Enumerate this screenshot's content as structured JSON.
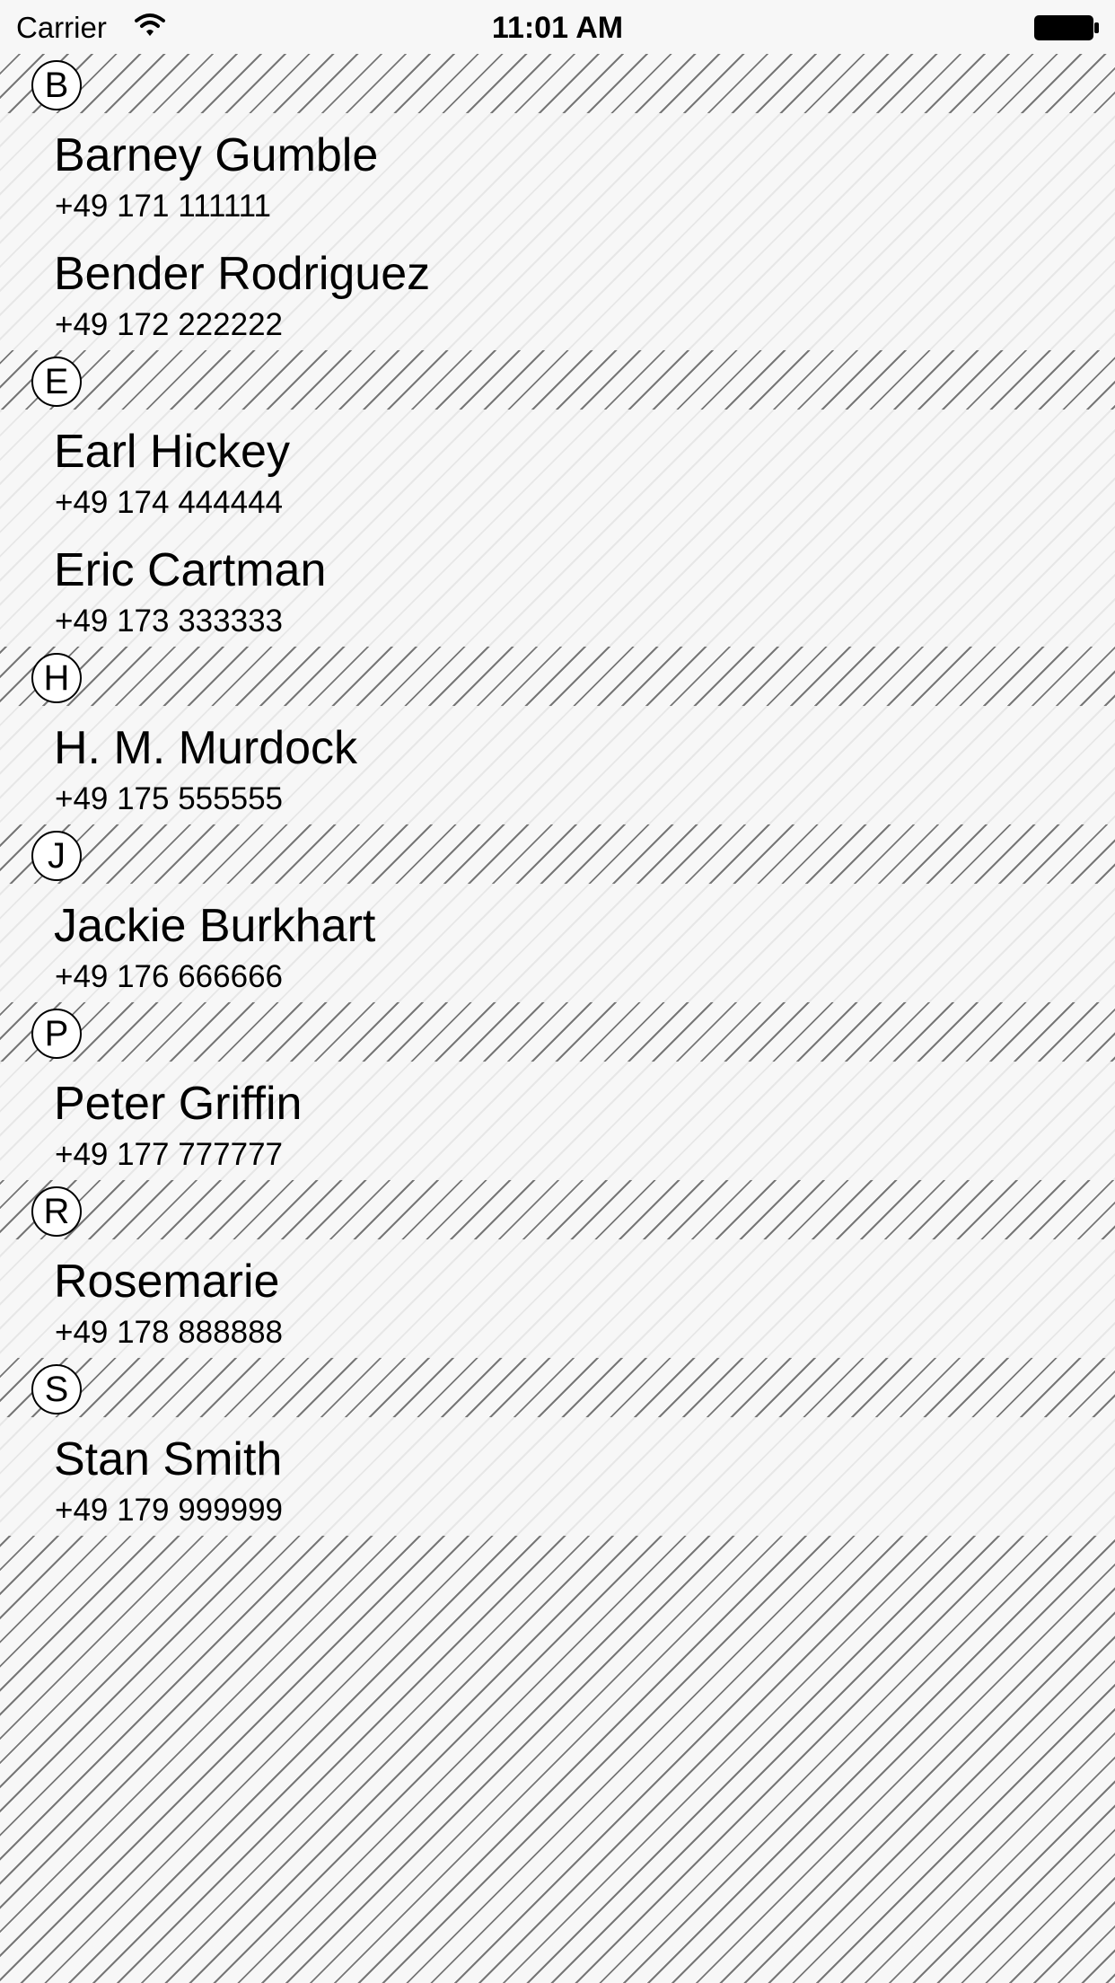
{
  "status_bar": {
    "carrier": "Carrier",
    "time": "11:01 AM",
    "wifi_icon": "wifi-icon",
    "battery_icon": "battery-icon"
  },
  "sections": [
    {
      "letter": "B",
      "contacts": [
        {
          "name": "Barney Gumble",
          "phone": "+49 171 111111"
        },
        {
          "name": "Bender Rodriguez",
          "phone": "+49 172 222222"
        }
      ]
    },
    {
      "letter": "E",
      "contacts": [
        {
          "name": "Earl Hickey",
          "phone": "+49 174 444444"
        },
        {
          "name": "Eric Cartman",
          "phone": "+49 173 333333"
        }
      ]
    },
    {
      "letter": "H",
      "contacts": [
        {
          "name": "H. M. Murdock",
          "phone": "+49 175 555555"
        }
      ]
    },
    {
      "letter": "J",
      "contacts": [
        {
          "name": "Jackie Burkhart",
          "phone": "+49 176 666666"
        }
      ]
    },
    {
      "letter": "P",
      "contacts": [
        {
          "name": "Peter Griffin",
          "phone": "+49 177 777777"
        }
      ]
    },
    {
      "letter": "R",
      "contacts": [
        {
          "name": "Rosemarie",
          "phone": "+49 178 888888"
        }
      ]
    },
    {
      "letter": "S",
      "contacts": [
        {
          "name": "Stan Smith",
          "phone": "+49 179 999999"
        }
      ]
    }
  ]
}
